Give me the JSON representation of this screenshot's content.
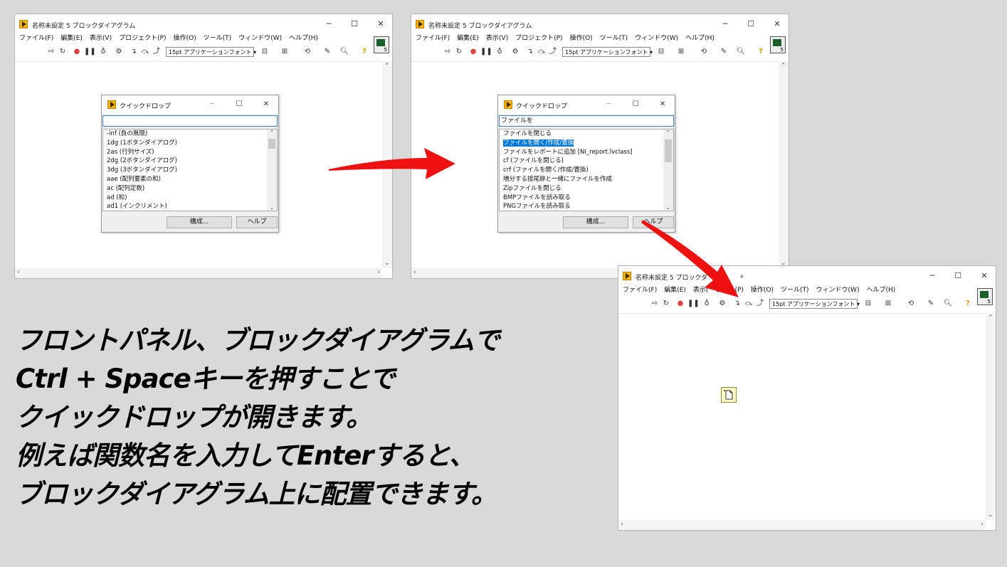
{
  "windows": [
    {
      "title": "名称未設定 5 ブロックダイアグラム",
      "menu": [
        "ファイル(F)",
        "編集(E)",
        "表示(V)",
        "プロジェクト(P)",
        "操作(O)",
        "ツール(T)",
        "ウィンドウ(W)",
        "ヘルプ(H)"
      ],
      "font_selector": "15pt アプリケーションフォント",
      "ctx_badge": "5"
    },
    {
      "title": "名称未設定 5 ブロックダイアグラム",
      "menu": [
        "ファイル(F)",
        "編集(E)",
        "表示(V)",
        "プロジェクト(P)",
        "操作(O)",
        "ツール(T)",
        "ウィンドウ(W)",
        "ヘルプ(H)"
      ],
      "font_selector": "15pt アプリケーションフォント",
      "ctx_badge": "5"
    },
    {
      "title": "名称未設定 5 ブロックダ",
      "title_suffix": "*",
      "menu": [
        "ファイル(F)",
        "編集(E)",
        "表示(",
        "ェクト(P)",
        "操作(O)",
        "ツール(T)",
        "ウィンドウ(W)",
        "ヘルプ(H)"
      ],
      "font_selector": "15pt アプリケーションフォント",
      "ctx_badge": "5"
    }
  ],
  "dialogs": [
    {
      "title": "クイックドロップ",
      "query": "",
      "items": [
        "-inf (負の無限)",
        "1dg (1ボタンダイアログ)",
        "2as (行列サイズ)",
        "2dg (2ボタンダイアログ)",
        "3dg (3ボタンダイアログ)",
        "aae (配列要素の和)",
        "ac (配列定数)",
        "ad (和)",
        "ad1 (インクリメント)"
      ],
      "selected_index": -1,
      "configure_label": "構成...",
      "help_label": "ヘルプ"
    },
    {
      "title": "クイックドロップ",
      "query": "ファイルを",
      "items": [
        "ファイルを閉じる",
        "ファイルを開く/作成/置換",
        "ファイルをレポートに追加 [NI_report.lvclass]",
        "cf (ファイルを閉じる)",
        "crf (ファイルを開く/作成/置換)",
        "増分する接尾辞と一緒にファイルを作成",
        "Zipファイルを閉じる",
        "BMPファイルを読み取る",
        "PNGファイルを読み取る"
      ],
      "selected_index": 1,
      "configure_label": "構成...",
      "help_label": "ヘルプ"
    }
  ],
  "caption": [
    "フロントパネル、ブロックダイアグラムで",
    "Ctrl + Spaceキーを押すことで",
    "クイックドロップが開きます。",
    "例えば関数名を入力してEnterすると、",
    "ブロックダイアグラム上に配置できます。"
  ],
  "colors": {
    "arrow": "#ee1111",
    "selection": "#0078d7",
    "accent_icon": "#f4b400"
  },
  "icons": [
    "run-arrow-icon",
    "run-continuous-icon",
    "abort-icon",
    "pause-icon",
    "highlight-execution-icon",
    "retain-wire-values-icon",
    "step-into-icon",
    "step-over-icon",
    "step-out-icon",
    "align-icon",
    "distribute-icon",
    "reorder-icon",
    "cleanup-icon",
    "search-icon",
    "help-icon"
  ]
}
